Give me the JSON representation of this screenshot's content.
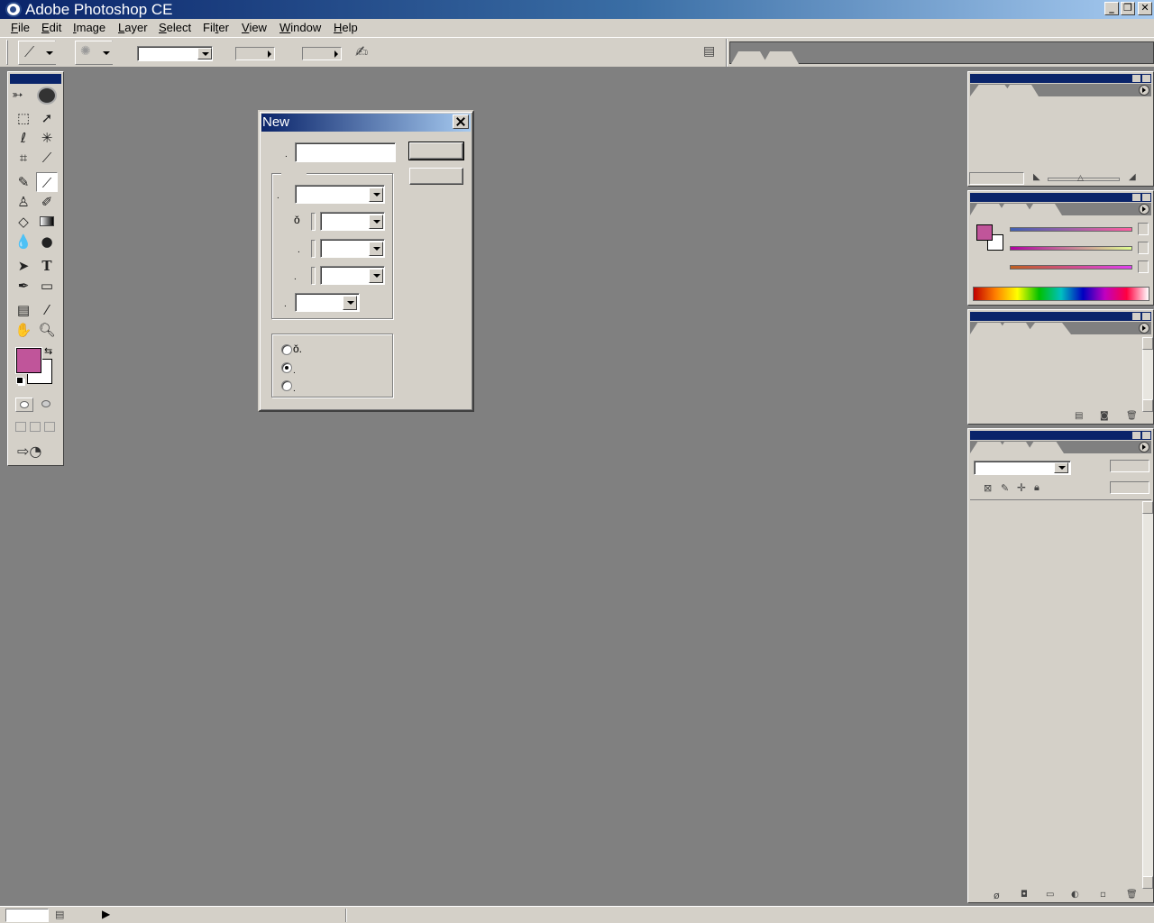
{
  "app": {
    "title": "Adobe Photoshop CE"
  },
  "window_controls": {
    "minimize": "_",
    "restore": "❐",
    "close": "✕"
  },
  "menu": [
    {
      "label": "File",
      "key": "F",
      "rest": "ile"
    },
    {
      "label": "Edit",
      "key": "E",
      "rest": "dit"
    },
    {
      "label": "Image",
      "key": "I",
      "rest": "mage"
    },
    {
      "label": "Layer",
      "key": "L",
      "rest": "ayer"
    },
    {
      "label": "Select",
      "key": "S",
      "rest": "elect"
    },
    {
      "label": "Filter",
      "key": "t",
      "pre": "Fil",
      "rest": "er"
    },
    {
      "label": "View",
      "key": "V",
      "rest": "iew"
    },
    {
      "label": "Window",
      "key": "W",
      "rest": "indow"
    },
    {
      "label": "Help",
      "key": "H",
      "rest": "elp"
    }
  ],
  "dialog": {
    "title": "New",
    "name_label": ".",
    "name_value": "",
    "size_fields": {
      "preset": "",
      "width": "",
      "height": "",
      "resolution": "",
      "mode": ""
    },
    "width_label": "ǒ",
    "height_label": ".",
    "resolution_label": ".",
    "mode_label": ".",
    "contents_options": [
      {
        "label": "ǒ.",
        "checked": false
      },
      {
        "label": ".",
        "checked": true
      },
      {
        "label": ".",
        "checked": false
      }
    ],
    "ok_label": "",
    "cancel_label": ""
  },
  "colors": {
    "foreground": "#c0559a",
    "background": "#ffffff",
    "canvas": "#808080",
    "chrome": "#d4d0c8",
    "title_dark": "#0a246a"
  },
  "toolbox": {
    "tools": [
      "marquee-icon",
      "move-icon",
      "lasso-icon",
      "magic-wand-icon",
      "crop-icon",
      "slice-icon",
      "healing-brush-icon",
      "brush-icon",
      "clone-stamp-icon",
      "history-brush-icon",
      "eraser-icon",
      "gradient-icon",
      "blur-icon",
      "dodge-icon",
      "path-select-icon",
      "type-icon",
      "pen-icon",
      "shape-icon",
      "notes-icon",
      "eyedropper-icon",
      "hand-icon",
      "zoom-icon"
    ]
  },
  "status": {
    "doc_info": ""
  }
}
